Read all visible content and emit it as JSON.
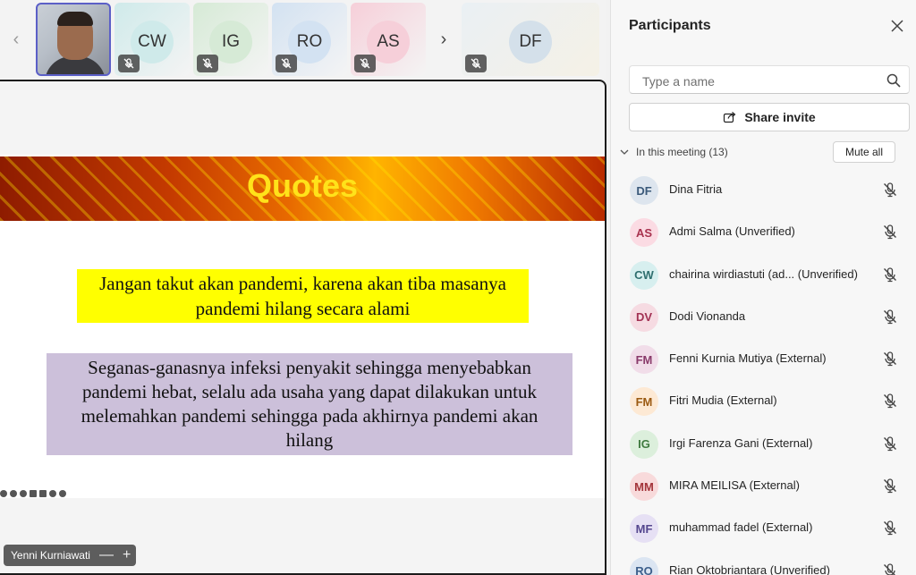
{
  "strip": {
    "prev_arrow": "‹",
    "next_arrow": "›",
    "tiles": [
      {
        "initials": "CW",
        "bg": "#cfeaea",
        "left": 0
      },
      {
        "initials": "IG",
        "bg": "#d6ead6",
        "left": 0
      },
      {
        "initials": "RO",
        "bg": "#d3e2f2",
        "left": 0
      },
      {
        "initials": "AS",
        "bg": "#f6cfd9",
        "left": 0
      }
    ],
    "wide_tile": {
      "initials": "DF",
      "bg": "#d4e0ea"
    }
  },
  "slide": {
    "title": "Quotes",
    "quote1": "Jangan takut akan pandemi, karena akan tiba masanya pandemi hilang secara alami",
    "quote2": "Seganas-ganasnya infeksi penyakit sehingga menyebabkan pandemi hebat, selalu ada usaha yang dapat dilakukan untuk melemahkan pandemi sehingga pada akhirnya pandemi akan hilang",
    "presenter": "Yenni Kurniawati",
    "zoom_out": "—",
    "zoom_in": "+"
  },
  "panel": {
    "title": "Participants",
    "search_placeholder": "Type a name",
    "share_label": "Share invite",
    "section_label": "In this meeting (13)",
    "mute_all_label": "Mute all",
    "participants": [
      {
        "initials": "DF",
        "name": "Dina Fitria",
        "bg": "#dde5ee",
        "fg": "#3b5a7a"
      },
      {
        "initials": "AS",
        "name": "Admi Salma (Unverified)",
        "bg": "#fbdbe3",
        "fg": "#a8334f"
      },
      {
        "initials": "CW",
        "name": "chairina wirdiastuti (ad...  (Unverified)",
        "bg": "#d7efef",
        "fg": "#2f6f6f"
      },
      {
        "initials": "DV",
        "name": "Dodi Vionanda",
        "bg": "#f6dbe2",
        "fg": "#a23153"
      },
      {
        "initials": "FM",
        "name": "Fenni Kurnia Mutiya (External)",
        "bg": "#f1dde9",
        "fg": "#8a3b6b"
      },
      {
        "initials": "FM",
        "name": "Fitri Mudia (External)",
        "bg": "#fde9d4",
        "fg": "#9b5a12"
      },
      {
        "initials": "IG",
        "name": "Irgi Farenza Gani (External)",
        "bg": "#dcefdc",
        "fg": "#3f7a3f"
      },
      {
        "initials": "MM",
        "name": "MIRA MEILISA (External)",
        "bg": "#f8dadb",
        "fg": "#a3343a"
      },
      {
        "initials": "MF",
        "name": "muhammad fadel (External)",
        "bg": "#e6e0f4",
        "fg": "#55478f"
      },
      {
        "initials": "RO",
        "name": "Rian Oktobriantara (Unverified)",
        "bg": "#dbe5f2",
        "fg": "#3d5f8c"
      }
    ]
  }
}
